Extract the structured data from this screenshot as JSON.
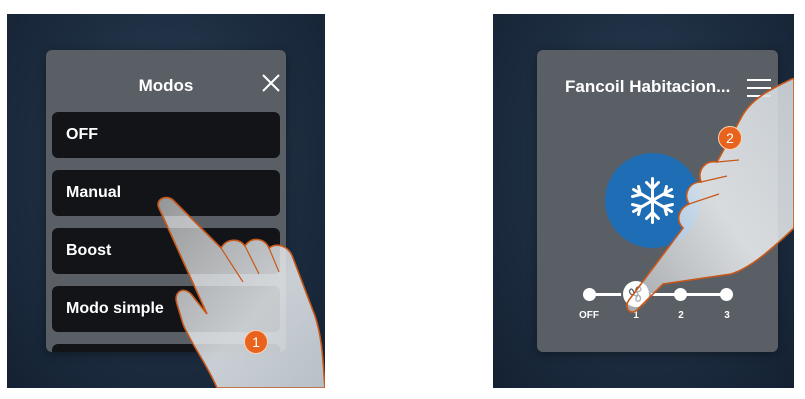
{
  "left_screen": {
    "title": "Modos",
    "close_icon": "close-icon",
    "modes": [
      "OFF",
      "Manual",
      "Boost",
      "Modo simple"
    ],
    "step_number": "1"
  },
  "right_screen": {
    "title": "Fancoil Habitacion...",
    "menu_icon": "hamburger-menu-icon",
    "mode_icon": "snowflake-icon",
    "speed_slider": {
      "labels": [
        "OFF",
        "1",
        "2",
        "3"
      ],
      "selected": "1",
      "thumb_icon": "fan-icon"
    },
    "step_number": "2"
  },
  "colors": {
    "background": "#1d2d40",
    "panel": "#5a5f66",
    "mode_item": "#121418",
    "cooling_blue": "#1f6db5",
    "step_badge": "#e8641e",
    "hand_outline": "#c8581a"
  }
}
